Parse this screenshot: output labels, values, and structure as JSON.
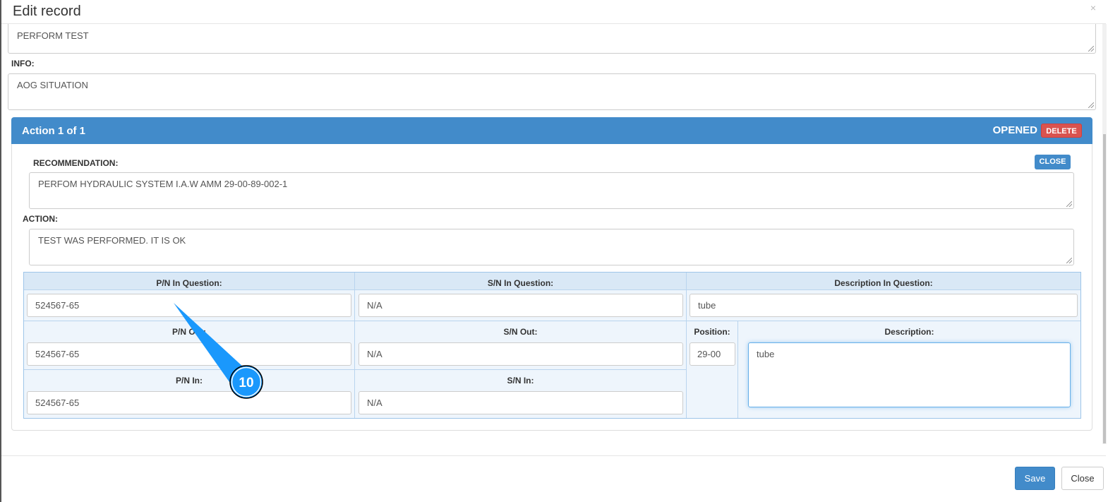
{
  "modal": {
    "title": "Edit record",
    "close_icon": "×"
  },
  "fields": {
    "perform_value": "PERFORM TEST",
    "info_label": "INFO:",
    "info_value": "AOG SITUATION"
  },
  "action": {
    "header": "Action 1 of 1",
    "status": "OPENED",
    "delete_label": "DELETE",
    "close_label": "CLOSE",
    "recommendation_label": "RECOMMENDATION:",
    "recommendation_value": "PERFOM HYDRAULIC SYSTEM I.A.W AMM 29-00-89-002-1",
    "action_label": "ACTION:",
    "action_value": "TEST WAS PERFORMED. IT IS OK",
    "pn_question_label": "P/N In Question:",
    "pn_question": "524567-65",
    "sn_question_label": "S/N In Question:",
    "sn_question": "N/A",
    "desc_question_label": "Description In Question:",
    "desc_question": "tube",
    "pn_out_label": "P/N Out:",
    "pn_out": "524567-65",
    "sn_out_label": "S/N Out:",
    "sn_out": "N/A",
    "position_label": "Position:",
    "position": "29-00",
    "description_label": "Description:",
    "description": "tube",
    "pn_in_label": "P/N In:",
    "pn_in": "524567-65",
    "sn_in_label": "S/N In:",
    "sn_in": "N/A"
  },
  "footer": {
    "save_label": "Save",
    "close_label": "Close"
  },
  "callout": {
    "number": "10",
    "color": "#1a98fc"
  }
}
